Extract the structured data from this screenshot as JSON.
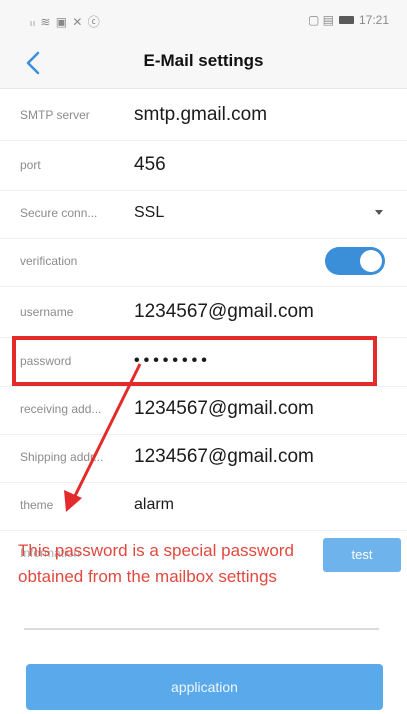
{
  "status_bar": {
    "left_icons_text": "ₗₗ ≋ ▣ ✕ ⓒ",
    "right_icons_text": "▢ ▤",
    "time": "17:21"
  },
  "nav": {
    "back_icon": "chevron-left-icon",
    "title": "E-Mail settings"
  },
  "fields": {
    "smtp": {
      "label": "SMTP server",
      "value": "smtp.gmail.com"
    },
    "port": {
      "label": "port",
      "value": "456"
    },
    "secure": {
      "label": "Secure conn...",
      "value": "SSL"
    },
    "verification": {
      "label": "verification",
      "enabled": true
    },
    "username": {
      "label": "username",
      "value": "1234567@gmail.com"
    },
    "password": {
      "label": "password",
      "value": "••••••••"
    },
    "receiving": {
      "label": "receiving add...",
      "value": "1234567@gmail.com"
    },
    "shipping": {
      "label": "Shipping addr...",
      "value": "1234567@gmail.com"
    },
    "theme": {
      "label": "theme",
      "value": "alarm"
    }
  },
  "information_label": "Information",
  "test_button": "test",
  "annotation": {
    "line1": "This password is a special password",
    "line2": "obtained from the mailbox settings",
    "color": "#e0493f"
  },
  "application_button": "application",
  "colors": {
    "accent": "#3b8fd9",
    "highlight": "#e32b2b",
    "button": "#5aa9ea"
  }
}
